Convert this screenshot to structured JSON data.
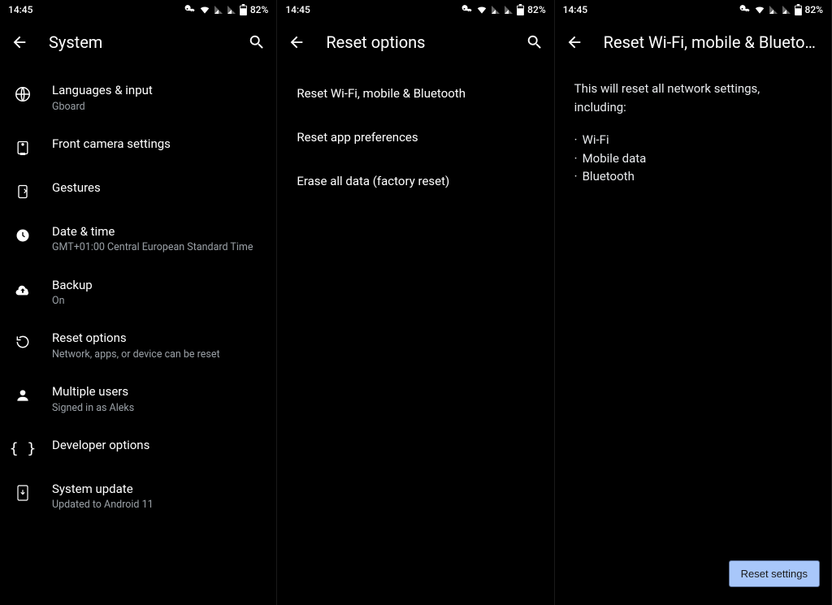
{
  "status": {
    "time": "14:45",
    "battery": "82%"
  },
  "panel1": {
    "title": "System",
    "items": [
      {
        "title": "Languages & input",
        "sub": "Gboard"
      },
      {
        "title": "Front camera settings",
        "sub": ""
      },
      {
        "title": "Gestures",
        "sub": ""
      },
      {
        "title": "Date & time",
        "sub": "GMT+01:00 Central European Standard Time"
      },
      {
        "title": "Backup",
        "sub": "On"
      },
      {
        "title": "Reset options",
        "sub": "Network, apps, or device can be reset"
      },
      {
        "title": "Multiple users",
        "sub": "Signed in as Aleks"
      },
      {
        "title": "Developer options",
        "sub": ""
      },
      {
        "title": "System update",
        "sub": "Updated to Android 11"
      }
    ]
  },
  "panel2": {
    "title": "Reset options",
    "items": [
      {
        "title": "Reset Wi-Fi, mobile & Bluetooth"
      },
      {
        "title": "Reset app preferences"
      },
      {
        "title": "Erase all data (factory reset)"
      }
    ]
  },
  "panel3": {
    "title": "Reset Wi-Fi, mobile & Blueto…",
    "description": "This will reset all network settings, including:",
    "bullets": [
      "Wi-Fi",
      "Mobile data",
      "Bluetooth"
    ],
    "button": "Reset settings"
  }
}
